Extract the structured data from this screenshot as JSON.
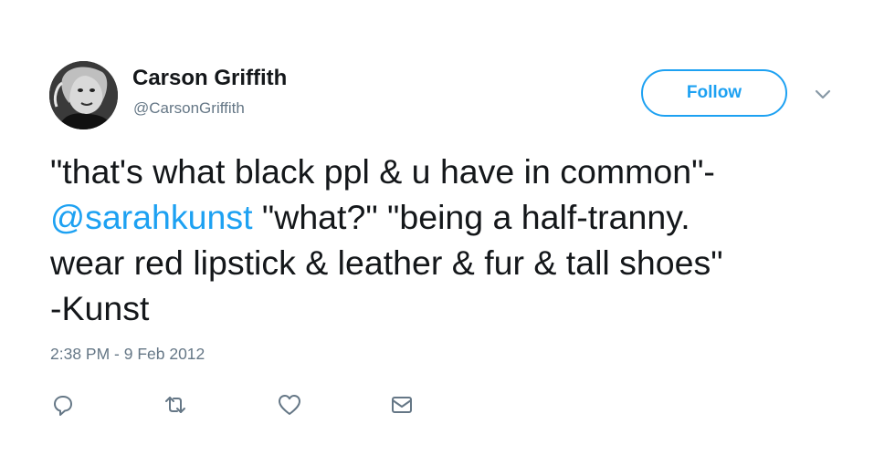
{
  "user": {
    "display_name": "Carson Griffith",
    "handle": "@CarsonGriffith",
    "avatar_icon": "profile-photo"
  },
  "follow_button": {
    "label": "Follow"
  },
  "menu": {
    "icon": "chevron-down-icon"
  },
  "tweet": {
    "text_before_mention": "\"that's what black ppl & u have in common\"-",
    "mention": "@sarahkunst",
    "text_after_mention": " \"what?\" \"being a half-tranny.\nwear red lipstick & leather & fur & tall shoes\"\n-Kunst",
    "timestamp": "2:38 PM - 9 Feb 2012"
  },
  "actions": [
    {
      "name": "reply",
      "icon": "reply-icon"
    },
    {
      "name": "retweet",
      "icon": "retweet-icon"
    },
    {
      "name": "like",
      "icon": "heart-icon"
    },
    {
      "name": "direct-message",
      "icon": "envelope-icon"
    }
  ],
  "colors": {
    "accent": "#1da1f2",
    "text": "#14171a",
    "secondary_text": "#657786",
    "icon": "#657786"
  }
}
